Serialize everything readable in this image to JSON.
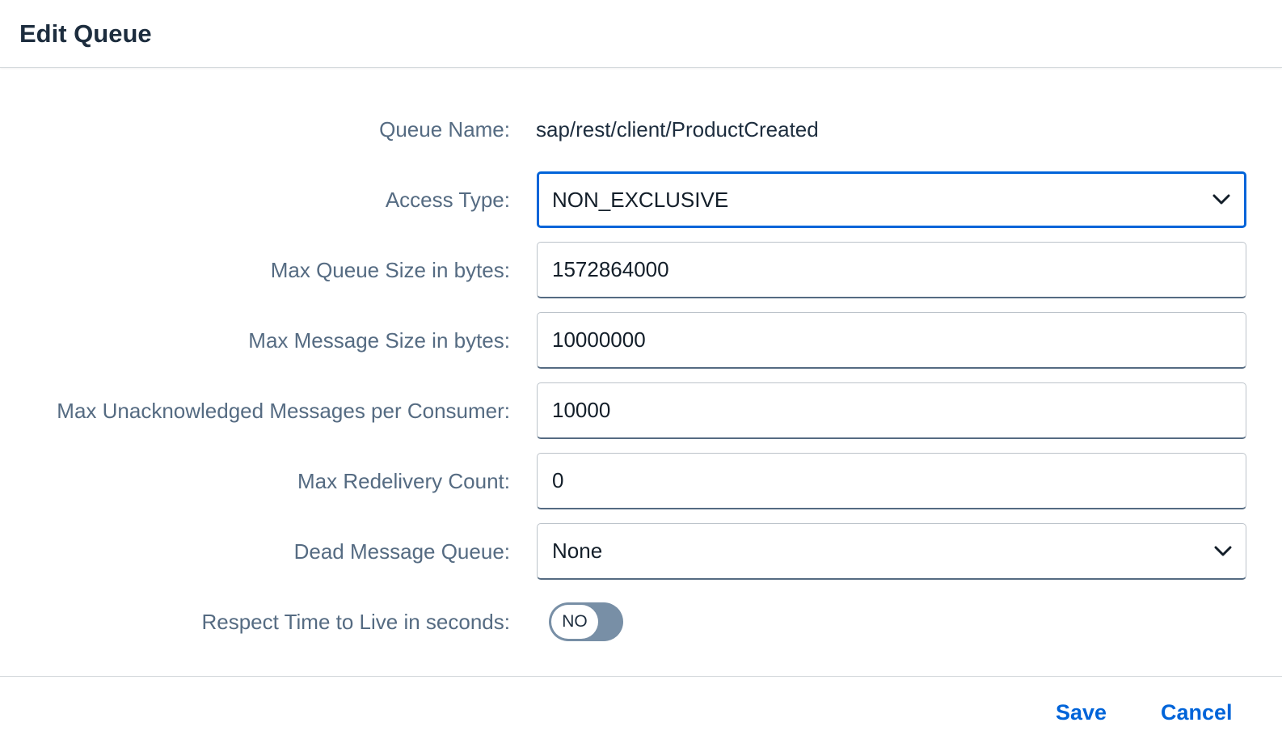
{
  "dialog": {
    "title": "Edit Queue"
  },
  "form": {
    "queue_name": {
      "label": "Queue Name:",
      "value": "sap/rest/client/ProductCreated"
    },
    "access_type": {
      "label": "Access Type:",
      "value": "NON_EXCLUSIVE",
      "icon": "chevron-down-icon"
    },
    "max_queue_size": {
      "label": "Max Queue Size in bytes:",
      "value": "1572864000"
    },
    "max_message_size": {
      "label": "Max Message Size in bytes:",
      "value": "10000000"
    },
    "max_unacked": {
      "label": "Max Unacknowledged Messages per Consumer:",
      "value": "10000"
    },
    "max_redelivery": {
      "label": "Max Redelivery Count:",
      "value": "0"
    },
    "dead_message_queue": {
      "label": "Dead Message Queue:",
      "value": "None",
      "icon": "chevron-down-icon"
    },
    "respect_ttl": {
      "label": "Respect Time to Live in seconds:",
      "state": "NO"
    }
  },
  "footer": {
    "save_label": "Save",
    "cancel_label": "Cancel"
  },
  "colors": {
    "accent": "#0064d9",
    "label": "#556b82",
    "text": "#1d2d3e",
    "toggle_off": "#788fa6"
  }
}
